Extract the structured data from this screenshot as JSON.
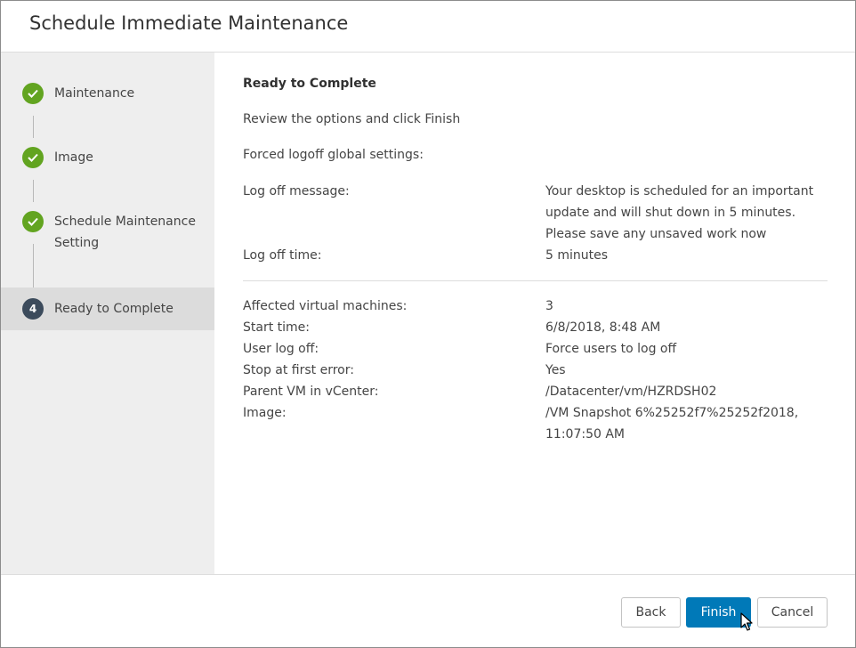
{
  "dialog": {
    "title": "Schedule Immediate Maintenance"
  },
  "wizard": {
    "steps": [
      {
        "label": "Maintenance",
        "status": "done"
      },
      {
        "label": "Image",
        "status": "done"
      },
      {
        "label": "Schedule Maintenance Setting",
        "status": "done"
      },
      {
        "label": "Ready to Complete",
        "status": "current",
        "number": "4"
      }
    ]
  },
  "summary": {
    "heading": "Ready to Complete",
    "instruction": "Review the options and click Finish",
    "group_label": "Forced logoff global settings:",
    "logoff_message_label": "Log off message:",
    "logoff_message_value": "Your desktop is scheduled for an important update and will shut down in 5 minutes. Please save any unsaved work now",
    "logoff_time_label": "Log off time:",
    "logoff_time_value": "5 minutes",
    "details": [
      {
        "label": "Affected virtual machines:",
        "value": "3"
      },
      {
        "label": "Start time:",
        "value": "6/8/2018, 8:48 AM"
      },
      {
        "label": "User log off:",
        "value": "Force users to log off"
      },
      {
        "label": "Stop at first error:",
        "value": "Yes"
      },
      {
        "label": "Parent VM in vCenter:",
        "value": "/Datacenter/vm/HZRDSH02"
      },
      {
        "label": "Image:",
        "value": "/VM Snapshot 6%25252f7%25252f2018, 11:07:50 AM"
      }
    ]
  },
  "footer": {
    "back_label": "Back",
    "finish_label": "Finish",
    "cancel_label": "Cancel"
  },
  "colors": {
    "step_done": "#62a420",
    "step_current": "#3c4b5c",
    "primary_button": "#0079b8"
  },
  "icons": {
    "step_done": "checkmark-icon",
    "pointer": "mouse-pointer-icon"
  }
}
